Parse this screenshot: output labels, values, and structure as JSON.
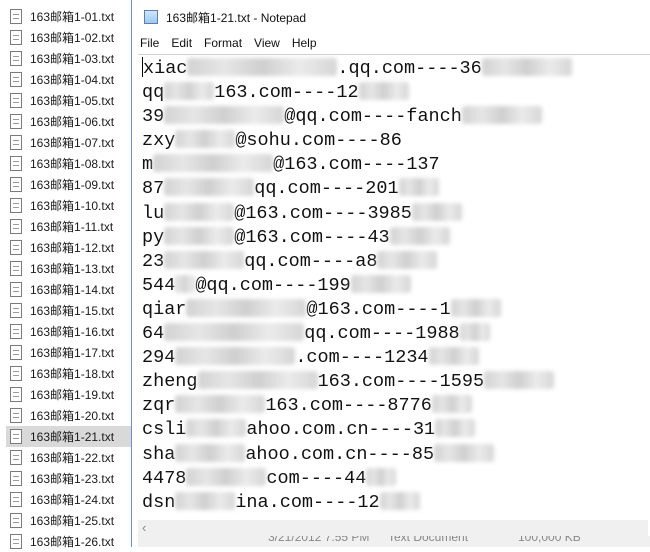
{
  "files": [
    "163邮箱1-01.txt",
    "163邮箱1-02.txt",
    "163邮箱1-03.txt",
    "163邮箱1-04.txt",
    "163邮箱1-05.txt",
    "163邮箱1-06.txt",
    "163邮箱1-07.txt",
    "163邮箱1-08.txt",
    "163邮箱1-09.txt",
    "163邮箱1-10.txt",
    "163邮箱1-11.txt",
    "163邮箱1-12.txt",
    "163邮箱1-13.txt",
    "163邮箱1-14.txt",
    "163邮箱1-15.txt",
    "163邮箱1-16.txt",
    "163邮箱1-17.txt",
    "163邮箱1-18.txt",
    "163邮箱1-19.txt",
    "163邮箱1-20.txt",
    "163邮箱1-21.txt",
    "163邮箱1-22.txt",
    "163邮箱1-23.txt",
    "163邮箱1-24.txt",
    "163邮箱1-25.txt",
    "163邮箱1-26.txt"
  ],
  "selected_file_index": 20,
  "window": {
    "title": "163邮箱1-21.txt - Notepad"
  },
  "menu": [
    "File",
    "Edit",
    "Format",
    "View",
    "Help"
  ],
  "lines": [
    "xiac",
    ".qq.com----36",
    "qq",
    "163.com----12",
    "39",
    "@qq.com----fanch",
    "zxy",
    "@sohu.com----86",
    "m",
    "@163.com----137",
    "87",
    "qq.com----201",
    "lu",
    "@163.com----3985",
    "py",
    "@163.com----43",
    "23",
    "qq.com----a8",
    "544",
    "@qq.com----199",
    "qiar",
    "@163.com----1",
    "64",
    "qq.com----1988",
    "294",
    ".com----1234",
    "zheng",
    "163.com----1595",
    "zqr",
    "163.com----8776",
    "csli",
    "ahoo.com.cn----31",
    "sha",
    "ahoo.com.cn----85",
    "4478",
    "com----44",
    "dsn",
    "ina.com----12"
  ],
  "status": {
    "date": "3/21/2012 7:55 PM",
    "type": "Text Document",
    "size": "100,000 KB"
  }
}
